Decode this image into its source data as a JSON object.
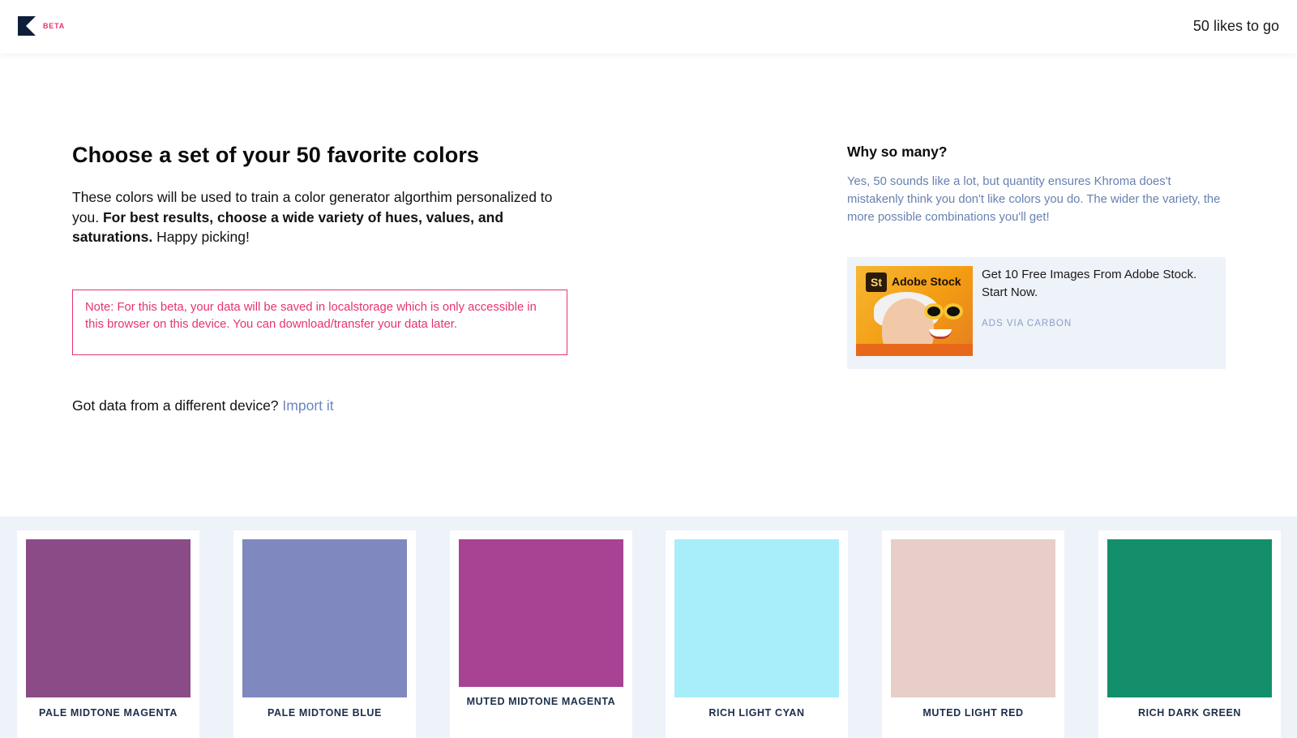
{
  "header": {
    "beta_label": "BETA",
    "likes_remaining": "50 likes to go"
  },
  "intro": {
    "title": "Choose a set of your 50 favorite colors",
    "desc_prefix": "These colors will be used to train a color generator algorthim personalized to you. ",
    "desc_bold": "For best results, choose a wide variety of hues, values, and saturations.",
    "desc_suffix": " Happy picking!",
    "note": "Note: For this beta, your data will be saved in localstorage which is only accessible in this browser on this device. You can download/transfer your data later.",
    "import_prompt": "Got data from a different device? ",
    "import_link": "Import it"
  },
  "sidebar": {
    "title": "Why so many?",
    "text": "Yes, 50 sounds like a lot, but quantity ensures Khroma does't mistakenly think you don't like colors you do. The wider the variety, the more possible combinations you'll get!"
  },
  "ad": {
    "image_brand": "Adobe Stock",
    "image_badge": "St",
    "copy": "Get 10 Free Images From Adobe Stock. Start Now.",
    "via": "ADS VIA CARBON"
  },
  "colors": [
    {
      "name": "PALE MIDTONE MAGENTA",
      "hex": "#8b4b87"
    },
    {
      "name": "PALE MIDTONE BLUE",
      "hex": "#8088c0"
    },
    {
      "name": "MUTED MIDTONE MAGENTA",
      "hex": "#a84293"
    },
    {
      "name": "RICH LIGHT CYAN",
      "hex": "#a8eefa"
    },
    {
      "name": "MUTED LIGHT RED",
      "hex": "#e8cec8"
    },
    {
      "name": "RICH DARK GREEN",
      "hex": "#13906b"
    }
  ],
  "theme": {
    "accent_pink": "#e8336d",
    "link_blue": "#6c87bf",
    "panel_bg": "#eef2f9"
  }
}
